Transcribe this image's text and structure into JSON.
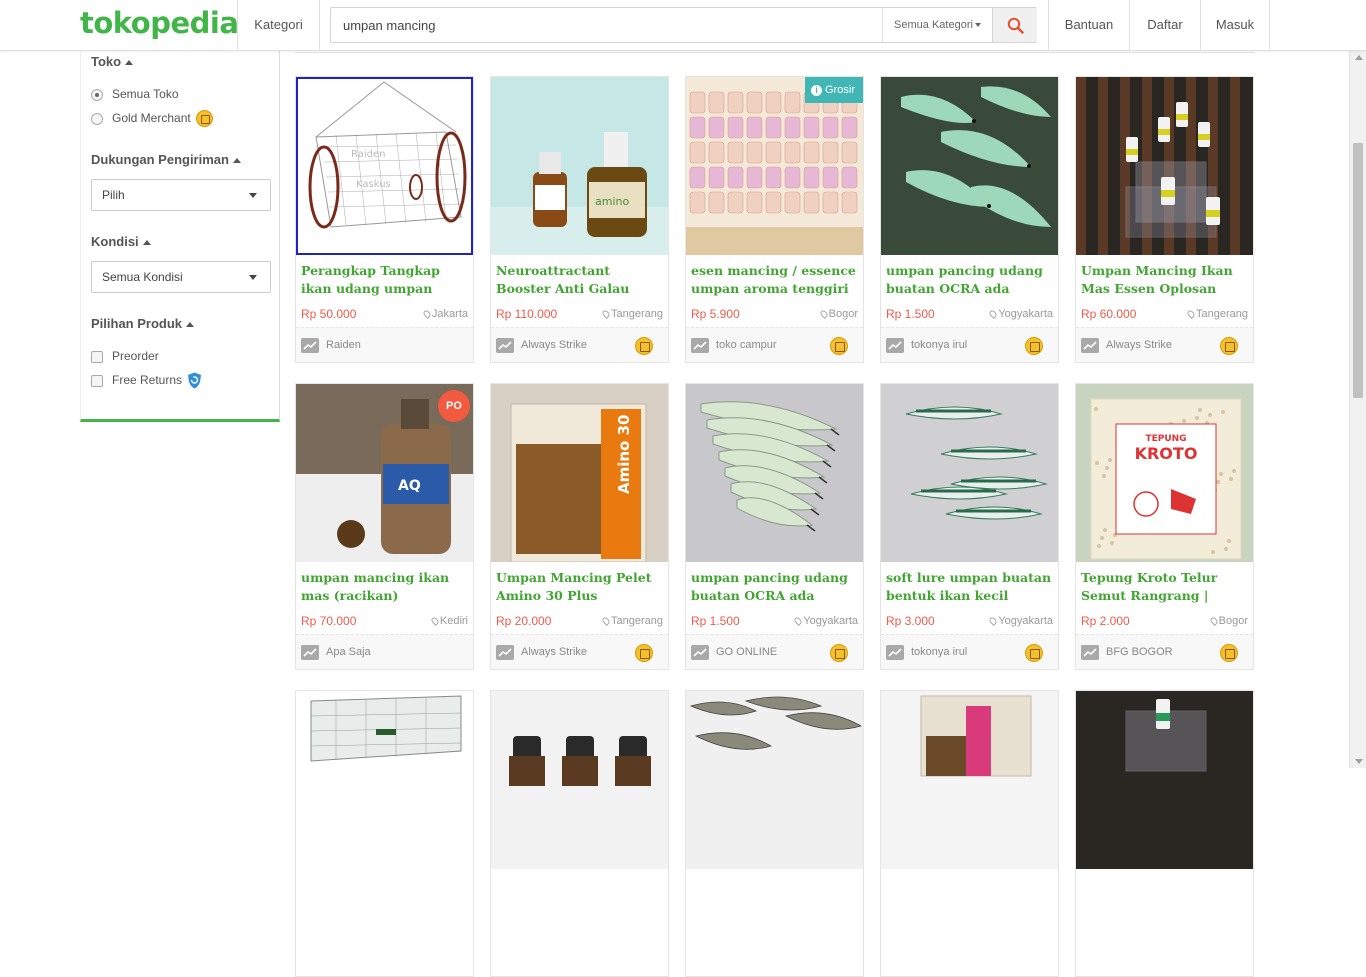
{
  "brand": {
    "logo": "tokopedia",
    "color": "#42b549"
  },
  "header": {
    "kategori": "Kategori",
    "search_value": "umpan mancing",
    "search_category": "Semua Kategori",
    "nav": [
      "Bantuan",
      "Daftar",
      "Masuk"
    ]
  },
  "sidebar": {
    "toko_title": "Toko",
    "toko_options": [
      {
        "label": "Semua Toko",
        "checked": true
      },
      {
        "label": "Gold Merchant",
        "checked": false
      }
    ],
    "shipping_title": "Dukungan Pengiriman",
    "shipping_select": "Pilih",
    "kondisi_title": "Kondisi",
    "kondisi_select": "Semua Kondisi",
    "produk_title": "Pilihan Produk",
    "produk_options": [
      "Preorder",
      "Free Returns"
    ]
  },
  "products": [
    {
      "name": "Perangkap Tangkap ikan udang umpan mancing",
      "price": "Rp 50.000",
      "location": "Jakarta",
      "shop": "Raiden",
      "gold": false,
      "badge": "",
      "image": "trap-net"
    },
    {
      "name": "Neuroattractant Booster Anti Galau Segala Jenis",
      "price": "Rp 110.000",
      "location": "Tangerang",
      "shop": "Always Strike",
      "gold": true,
      "badge": "",
      "image": "bottles-green"
    },
    {
      "name": "esen mancing / essence umpan aroma tenggiri",
      "price": "Rp 5.900",
      "location": "Bogor",
      "shop": "toko campur",
      "gold": true,
      "badge": "Grosir",
      "image": "essence-rows"
    },
    {
      "name": "umpan pancing udang buatan OCRA ada matakail",
      "price": "Rp 1.500",
      "location": "Yogyakarta",
      "shop": "tokonya irul",
      "gold": true,
      "badge": "",
      "image": "glow-shrimp"
    },
    {
      "name": "Umpan Mancing Ikan Mas Essen Oplosan Galatama",
      "price": "Rp 60.000",
      "location": "Tangerang",
      "shop": "Always Strike",
      "gold": true,
      "badge": "",
      "image": "dropper-stand"
    },
    {
      "name": "umpan mancing ikan mas (racikan)",
      "price": "Rp 70.000",
      "location": "Kediri",
      "shop": "Apa Saja",
      "gold": false,
      "badge": "PO",
      "image": "aqua-bottle"
    },
    {
      "name": "Umpan Mancing Pelet Amino 30 Plus",
      "price": "Rp 20.000",
      "location": "Tangerang",
      "shop": "Always Strike",
      "gold": true,
      "badge": "",
      "image": "amino-pack"
    },
    {
      "name": "umpan pancing udang buatan OCRA ada matakail",
      "price": "Rp 1.500",
      "location": "Yogyakarta",
      "shop": "GO ONLINE",
      "gold": true,
      "badge": "",
      "image": "shrimp-lures"
    },
    {
      "name": "soft lure umpan buatan bentuk ikan kecil untuk",
      "price": "Rp 3.000",
      "location": "Yogyakarta",
      "shop": "tokonya irul",
      "gold": true,
      "badge": "",
      "image": "fish-lures"
    },
    {
      "name": "Tepung Kroto Telur Semut Rangrang | Umpan",
      "price": "Rp 2.000",
      "location": "Bogor",
      "shop": "BFG BOGOR",
      "gold": true,
      "badge": "",
      "image": "kroto-bag"
    }
  ],
  "partial_row_images": [
    "trap-net-2",
    "dark-bottles",
    "fish-lures-2",
    "amino-pack-2",
    "dropper-stand-2"
  ]
}
